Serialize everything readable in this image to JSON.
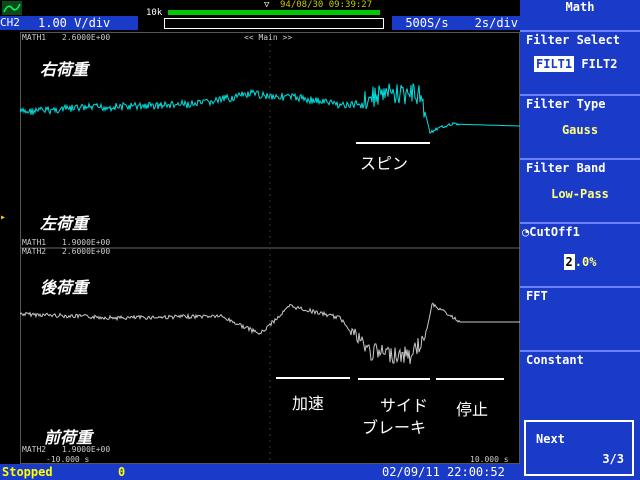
{
  "topbar": {
    "channel": "CH2",
    "volts_div": "1.00 V/div",
    "memory_label": "10k",
    "datetime": "94/08/30 09:39:27",
    "sample_rate": "500S/s",
    "time_div": "2s/div"
  },
  "graph": {
    "upper": {
      "header_left": "MATH1",
      "header_value": "2.6000E+00",
      "header_center": "<< Main >>",
      "footer_left": "MATH1",
      "footer_value": "1.9000E+00"
    },
    "lower": {
      "header_left": "MATH2",
      "header_value": "2.6000E+00",
      "footer_left": "MATH2",
      "footer_value": "1.9000E+00"
    },
    "labels": {
      "right_load": "右荷重",
      "left_load": "左荷重",
      "rear_load": "後荷重",
      "front_load": "前荷重"
    },
    "annotations": {
      "spin": "スピン",
      "accel": "加速",
      "side_brake_1": "サイド",
      "side_brake_2": "ブレーキ",
      "stop": "停止"
    },
    "time_left": "-10.000 s",
    "time_right": "10.000 s"
  },
  "status": {
    "state": "Stopped",
    "count": "0",
    "datetime": "02/09/11 22:00:52"
  },
  "menu": {
    "title": "Math",
    "filter_select": {
      "label": "Filter Select",
      "opt1": "FILT1",
      "opt2": "FILT2"
    },
    "filter_type": {
      "label": "Filter Type",
      "value": "Gauss"
    },
    "filter_band": {
      "label": "Filter Band",
      "value": "Low-Pass"
    },
    "cutoff": {
      "label": "CutOff1",
      "value_digit": "2",
      "value_rest": ".0%"
    },
    "fft": {
      "label": "FFT"
    },
    "constant": {
      "label": "Constant"
    },
    "next": {
      "label": "Next",
      "page": "3/3"
    }
  },
  "colors": {
    "menu_bg": "#1a3ac8",
    "trace_upper": "#00e0e0",
    "trace_lower": "#c8c8c8",
    "status_text": "#ffff00"
  }
}
